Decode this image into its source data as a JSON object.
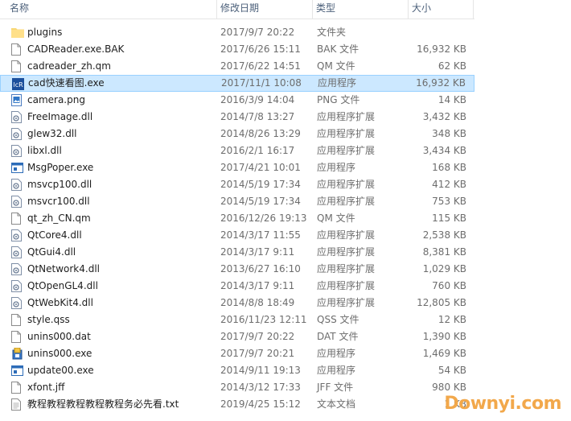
{
  "columns": {
    "name": "名称",
    "date": "修改日期",
    "type": "类型",
    "size": "大小"
  },
  "files": [
    {
      "name": "plugins",
      "date": "2017/9/7 20:22",
      "type": "文件夹",
      "size": "",
      "icon": "folder-icon"
    },
    {
      "name": "CADReader.exe.BAK",
      "date": "2017/6/26 15:11",
      "type": "BAK 文件",
      "size": "16,932 KB",
      "icon": "file-icon"
    },
    {
      "name": "cadreader_zh.qm",
      "date": "2017/6/22 14:51",
      "type": "QM 文件",
      "size": "62 KB",
      "icon": "file-icon"
    },
    {
      "name": "cad快速看图.exe",
      "date": "2017/11/1 10:08",
      "type": "应用程序",
      "size": "16,932 KB",
      "icon": "cad-app-icon"
    },
    {
      "name": "camera.png",
      "date": "2016/3/9 14:04",
      "type": "PNG 文件",
      "size": "14 KB",
      "icon": "image-file-icon"
    },
    {
      "name": "FreeImage.dll",
      "date": "2014/7/8 13:27",
      "type": "应用程序扩展",
      "size": "3,432 KB",
      "icon": "dll-icon"
    },
    {
      "name": "glew32.dll",
      "date": "2014/8/26 13:29",
      "type": "应用程序扩展",
      "size": "348 KB",
      "icon": "dll-icon"
    },
    {
      "name": "libxl.dll",
      "date": "2016/2/1 16:17",
      "type": "应用程序扩展",
      "size": "3,434 KB",
      "icon": "dll-icon"
    },
    {
      "name": "MsgPoper.exe",
      "date": "2017/4/21 10:01",
      "type": "应用程序",
      "size": "168 KB",
      "icon": "exe-icon"
    },
    {
      "name": "msvcp100.dll",
      "date": "2014/5/19 17:34",
      "type": "应用程序扩展",
      "size": "412 KB",
      "icon": "dll-icon"
    },
    {
      "name": "msvcr100.dll",
      "date": "2014/5/19 17:34",
      "type": "应用程序扩展",
      "size": "753 KB",
      "icon": "dll-icon"
    },
    {
      "name": "qt_zh_CN.qm",
      "date": "2016/12/26 19:13",
      "type": "QM 文件",
      "size": "115 KB",
      "icon": "file-icon"
    },
    {
      "name": "QtCore4.dll",
      "date": "2014/3/17 11:55",
      "type": "应用程序扩展",
      "size": "2,538 KB",
      "icon": "dll-icon"
    },
    {
      "name": "QtGui4.dll",
      "date": "2014/3/17 9:11",
      "type": "应用程序扩展",
      "size": "8,381 KB",
      "icon": "dll-icon"
    },
    {
      "name": "QtNetwork4.dll",
      "date": "2013/6/27 16:10",
      "type": "应用程序扩展",
      "size": "1,029 KB",
      "icon": "dll-icon"
    },
    {
      "name": "QtOpenGL4.dll",
      "date": "2014/3/17 9:11",
      "type": "应用程序扩展",
      "size": "760 KB",
      "icon": "dll-icon"
    },
    {
      "name": "QtWebKit4.dll",
      "date": "2014/8/8 18:49",
      "type": "应用程序扩展",
      "size": "12,805 KB",
      "icon": "dll-icon"
    },
    {
      "name": "style.qss",
      "date": "2016/11/23 12:11",
      "type": "QSS 文件",
      "size": "12 KB",
      "icon": "file-icon"
    },
    {
      "name": "unins000.dat",
      "date": "2017/9/7 20:22",
      "type": "DAT 文件",
      "size": "1,390 KB",
      "icon": "file-icon"
    },
    {
      "name": "unins000.exe",
      "date": "2017/9/7 20:21",
      "type": "应用程序",
      "size": "1,469 KB",
      "icon": "installer-icon"
    },
    {
      "name": "update00.exe",
      "date": "2014/9/11 19:13",
      "type": "应用程序",
      "size": "54 KB",
      "icon": "exe-icon"
    },
    {
      "name": "xfont.jff",
      "date": "2014/3/12 17:33",
      "type": "JFF 文件",
      "size": "980 KB",
      "icon": "file-icon"
    },
    {
      "name": "教程教程教程教程教程务必先看.txt",
      "date": "2019/4/25 15:12",
      "type": "文本文档",
      "size": "1 KB",
      "icon": "text-file-icon"
    }
  ],
  "selected_index": 3,
  "watermark": "Downyi.com",
  "colors": {
    "header_text": "#4c607a",
    "selection_bg": "#cce8ff",
    "selection_border": "#99d1ff",
    "folder": "#f8d775",
    "watermark": "#f2a84b"
  }
}
